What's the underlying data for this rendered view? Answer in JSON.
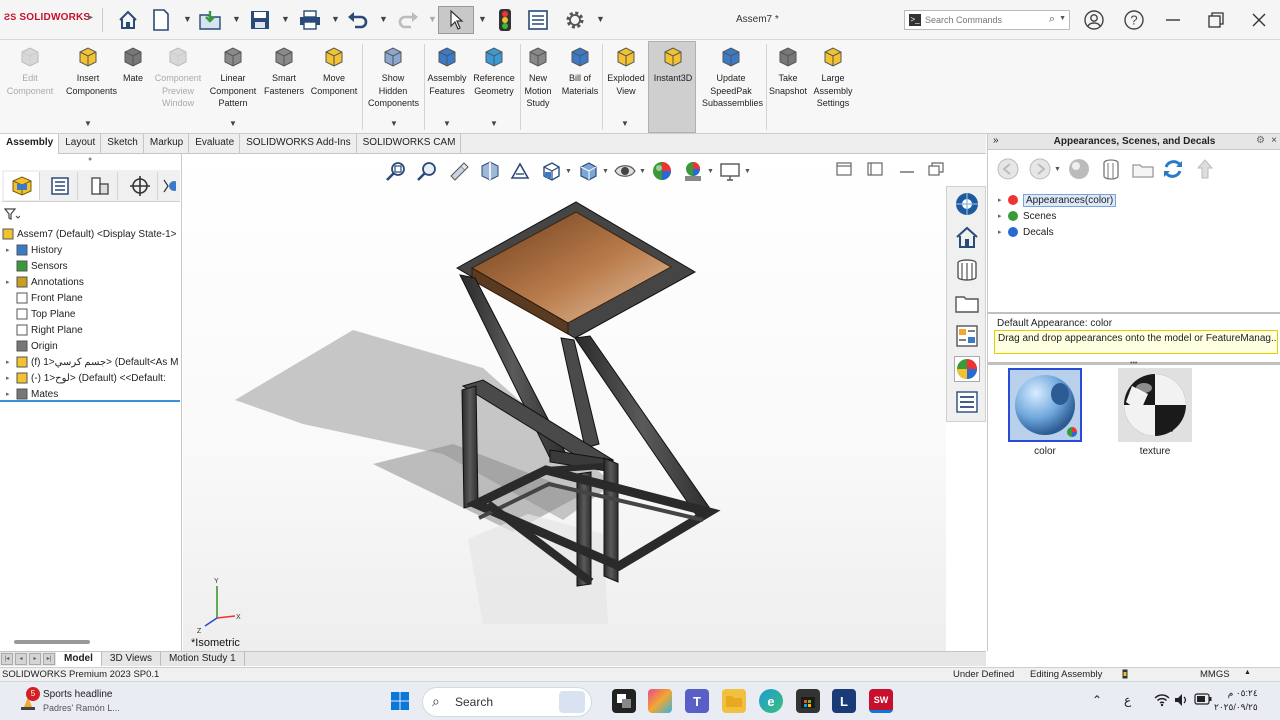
{
  "app": {
    "logo": "SOLIDWORKS",
    "doc_title": "Assem7 *",
    "search_placeholder": "Search Commands",
    "help": "?"
  },
  "ribbon": {
    "buttons": [
      {
        "label": "Edit Component",
        "lines": [
          "Edit",
          "Component"
        ],
        "disabled": true,
        "icon": "edit-component-icon"
      },
      {
        "label": "Insert Components",
        "lines": [
          "Insert",
          "Components"
        ],
        "disabled": false,
        "icon": "insert-components-icon"
      },
      {
        "label": "Mate",
        "lines": [
          "Mate"
        ],
        "disabled": false,
        "icon": "mate-icon"
      },
      {
        "label": "Component Preview Window",
        "lines": [
          "Component",
          "Preview",
          "Window"
        ],
        "disabled": true,
        "icon": "preview-window-icon"
      },
      {
        "label": "Linear Component Pattern",
        "lines": [
          "Linear",
          "Component",
          "Pattern"
        ],
        "disabled": false,
        "icon": "linear-pattern-icon"
      },
      {
        "label": "Smart Fasteners",
        "lines": [
          "Smart",
          "Fasteners"
        ],
        "disabled": false,
        "icon": "smart-fasteners-icon"
      },
      {
        "label": "Move Component",
        "lines": [
          "Move",
          "Component"
        ],
        "disabled": false,
        "icon": "move-component-icon"
      },
      {
        "label": "Show Hidden Components",
        "lines": [
          "Show",
          "Hidden",
          "Components"
        ],
        "disabled": false,
        "icon": "show-hidden-icon"
      },
      {
        "label": "Assembly Features",
        "lines": [
          "Assembly",
          "Features"
        ],
        "disabled": false,
        "icon": "assembly-features-icon"
      },
      {
        "label": "Reference Geometry",
        "lines": [
          "Reference",
          "Geometry"
        ],
        "disabled": false,
        "icon": "reference-geometry-icon"
      },
      {
        "label": "New Motion Study",
        "lines": [
          "New",
          "Motion",
          "Study"
        ],
        "disabled": false,
        "icon": "motion-study-icon"
      },
      {
        "label": "Bill of Materials",
        "lines": [
          "Bill of",
          "Materials"
        ],
        "disabled": false,
        "icon": "bom-icon"
      },
      {
        "label": "Exploded View",
        "lines": [
          "Exploded",
          "View"
        ],
        "disabled": false,
        "icon": "exploded-view-icon"
      },
      {
        "label": "Instant3D",
        "lines": [
          "Instant3D"
        ],
        "disabled": false,
        "icon": "instant3d-icon"
      },
      {
        "label": "Update SpeedPak Subassemblies",
        "lines": [
          "Update",
          "SpeedPak",
          "Subassemblies"
        ],
        "disabled": false,
        "icon": "speedpak-icon"
      },
      {
        "label": "Take Snapshot",
        "lines": [
          "Take",
          "Snapshot"
        ],
        "disabled": false,
        "icon": "snapshot-icon"
      },
      {
        "label": "Large Assembly Settings",
        "lines": [
          "Large",
          "Assembly",
          "Settings"
        ],
        "disabled": false,
        "icon": "large-assembly-icon"
      }
    ]
  },
  "tabs": [
    "Assembly",
    "Layout",
    "Sketch",
    "Markup",
    "Evaluate",
    "SOLIDWORKS Add-Ins",
    "SOLIDWORKS CAM"
  ],
  "tree": {
    "items": [
      {
        "label": "Assem7 (Default) <Display State-1>",
        "expander": "",
        "icon": "assembly-icon"
      },
      {
        "label": "History",
        "expander": "▸",
        "icon": "history-icon"
      },
      {
        "label": "Sensors",
        "expander": "",
        "icon": "sensors-icon"
      },
      {
        "label": "Annotations",
        "expander": "▸",
        "icon": "annotations-icon"
      },
      {
        "label": "Front Plane",
        "expander": "",
        "icon": "plane-icon"
      },
      {
        "label": "Top Plane",
        "expander": "",
        "icon": "plane-icon"
      },
      {
        "label": "Right Plane",
        "expander": "",
        "icon": "plane-icon"
      },
      {
        "label": "Origin",
        "expander": "",
        "icon": "origin-icon"
      },
      {
        "label": "(f) جسم كرسي<1> (Default<As M",
        "expander": "▸",
        "icon": "part-icon"
      },
      {
        "label": "(-) لوح<1> (Default) <<Default:",
        "expander": "▸",
        "icon": "part-icon"
      },
      {
        "label": "Mates",
        "expander": "▸",
        "icon": "mates-icon"
      }
    ]
  },
  "viewport": {
    "view_label": "*Isometric"
  },
  "task_pane": {
    "title": "Appearances, Scenes, and Decals",
    "tree": [
      {
        "label": "Appearances(color)",
        "selected": true
      },
      {
        "label": "Scenes",
        "selected": false
      },
      {
        "label": "Decals",
        "selected": false
      }
    ],
    "default_appearance": "Default Appearance: color",
    "tooltip": "Drag and drop appearances onto the model or FeatureManag...",
    "thumbnails": [
      {
        "label": "color"
      },
      {
        "label": "texture"
      }
    ]
  },
  "model_tabs": [
    "Model",
    "3D Views",
    "Motion Study 1"
  ],
  "status": {
    "product": "SOLIDWORKS Premium 2023 SP0.1",
    "defined": "Under Defined",
    "mode": "Editing Assembly",
    "units": "MMGS"
  },
  "taskbar": {
    "news_title": "Sports headline",
    "news_sub": "Padres' Ramón L...",
    "badge": "5",
    "search": "Search",
    "lang": "ع",
    "time": "٠٥:٢٤ م",
    "date": "٢٠٢٥/٠٩/٢٥"
  }
}
